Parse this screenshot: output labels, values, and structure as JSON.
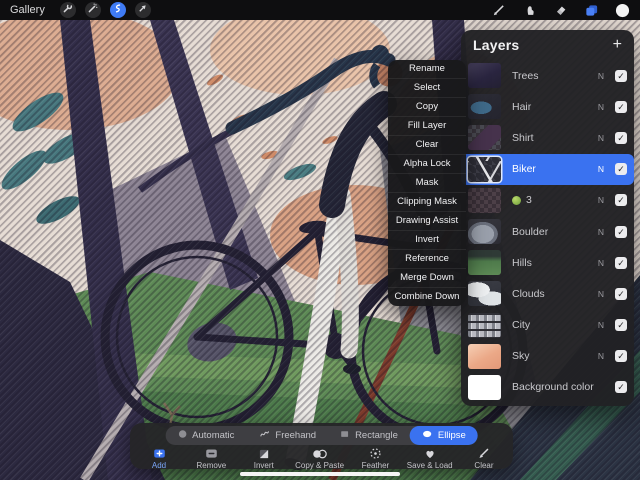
{
  "app": {
    "name_hint": "Procreate-style painting app",
    "accent": "#3a72f0"
  },
  "topbar": {
    "gallery_label": "Gallery",
    "left_tools": [
      {
        "icon": "wrench-icon",
        "active": false
      },
      {
        "icon": "adjustments-wand-icon",
        "active": false
      },
      {
        "icon": "selection-s-icon",
        "active": true
      },
      {
        "icon": "transform-arrow-icon",
        "active": false
      }
    ],
    "right_tools": [
      {
        "icon": "brush-icon",
        "active": false
      },
      {
        "icon": "smudge-finger-icon",
        "active": false
      },
      {
        "icon": "eraser-icon",
        "active": false
      },
      {
        "icon": "layers-stack-icon",
        "active": true
      },
      {
        "icon": "color-disc-icon",
        "active": false
      }
    ]
  },
  "layers_panel": {
    "title": "Layers",
    "add_button": "+",
    "blend_mode_letter": "N",
    "layers": [
      {
        "name": "Trees",
        "blend": "N",
        "checked": true,
        "selected": false,
        "thumb": "trees"
      },
      {
        "name": "Hair",
        "blend": "N",
        "checked": true,
        "selected": false,
        "thumb": "hair"
      },
      {
        "name": "Shirt",
        "blend": "N",
        "checked": true,
        "selected": false,
        "thumb": "shirt"
      },
      {
        "name": "Biker",
        "blend": "N",
        "checked": true,
        "selected": true,
        "thumb": "biker"
      },
      {
        "name": "3",
        "blend": "N",
        "checked": true,
        "selected": false,
        "thumb": "group3",
        "icon": "green-ball-icon"
      },
      {
        "name": "Boulder",
        "blend": "N",
        "checked": true,
        "selected": false,
        "thumb": "boulder"
      },
      {
        "name": "Hills",
        "blend": "N",
        "checked": true,
        "selected": false,
        "thumb": "hills"
      },
      {
        "name": "Clouds",
        "blend": "N",
        "checked": true,
        "selected": false,
        "thumb": "clouds"
      },
      {
        "name": "City",
        "blend": "N",
        "checked": true,
        "selected": false,
        "thumb": "city"
      },
      {
        "name": "Sky",
        "blend": "N",
        "checked": true,
        "selected": false,
        "thumb": "sky"
      },
      {
        "name": "Background color",
        "blend": "",
        "checked": true,
        "selected": false,
        "thumb": "bgcolor"
      }
    ]
  },
  "context_menu": {
    "items": [
      "Rename",
      "Select",
      "Copy",
      "Fill Layer",
      "Clear",
      "Alpha Lock",
      "Mask",
      "Clipping Mask",
      "Drawing Assist",
      "Invert",
      "Reference",
      "Merge Down",
      "Combine Down"
    ]
  },
  "selection_toolbar": {
    "modes": [
      {
        "label": "Automatic",
        "icon": "automatic-circle-icon",
        "selected": false
      },
      {
        "label": "Freehand",
        "icon": "freehand-squiggle-icon",
        "selected": false
      },
      {
        "label": "Rectangle",
        "icon": "rectangle-icon",
        "selected": false
      },
      {
        "label": "Ellipse",
        "icon": "ellipse-icon",
        "selected": true
      }
    ],
    "actions": [
      {
        "label": "Add",
        "icon": "add-plus-icon",
        "active": true
      },
      {
        "label": "Remove",
        "icon": "remove-minus-icon",
        "active": false
      },
      {
        "label": "Invert",
        "icon": "invert-square-icon",
        "active": false
      },
      {
        "label": "Copy & Paste",
        "icon": "copy-paste-circles-icon",
        "active": false
      },
      {
        "label": "Feather",
        "icon": "feather-dotted-circle-icon",
        "active": false
      },
      {
        "label": "Save & Load",
        "icon": "heart-icon",
        "active": false
      },
      {
        "label": "Clear",
        "icon": "clear-brush-icon",
        "active": false
      }
    ]
  }
}
